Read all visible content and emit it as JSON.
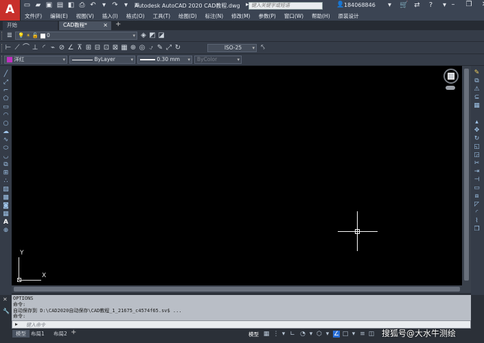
{
  "app": {
    "logo_letter": "A",
    "title": "Autodesk AutoCAD 2020    CAD教程.dwg",
    "search_placeholder": "键入关键字或短语",
    "user_name": "184068846"
  },
  "menu": {
    "items": [
      "文件(F)",
      "编辑(E)",
      "视图(V)",
      "插入(I)",
      "格式(O)",
      "工具(T)",
      "绘图(D)",
      "标注(N)",
      "修改(M)",
      "参数(P)",
      "窗口(W)",
      "帮助(H)",
      "原装设计"
    ]
  },
  "tabs": {
    "start": "开始",
    "drawing": "CAD教程*",
    "close": "×",
    "add": "+"
  },
  "layer_toolbar": {
    "current_layer": "0"
  },
  "dim_toolbar": {
    "dim_style": "ISO-25"
  },
  "properties_toolbar": {
    "color": "洋红",
    "color_hex": "#c030c0",
    "linetype": "ByLayer",
    "lineweight": "0.30 mm",
    "plotstyle": "ByColor"
  },
  "canvas": {
    "background": "#000000",
    "ucs_x": "X",
    "ucs_y": "Y"
  },
  "command": {
    "history": [
      "OPTIONS",
      "命令:",
      "自动保存到 D:\\CAD2020自动保存\\CAD教程_1_21675_c4574f65.sv$ ...",
      "命令:"
    ],
    "input_placeholder": "键入命令"
  },
  "status": {
    "model_tab": "模型",
    "layout1": "布局1",
    "layout2": "布局2",
    "model_label": "模型",
    "watermark": "搜狐号@大水牛测绘"
  }
}
